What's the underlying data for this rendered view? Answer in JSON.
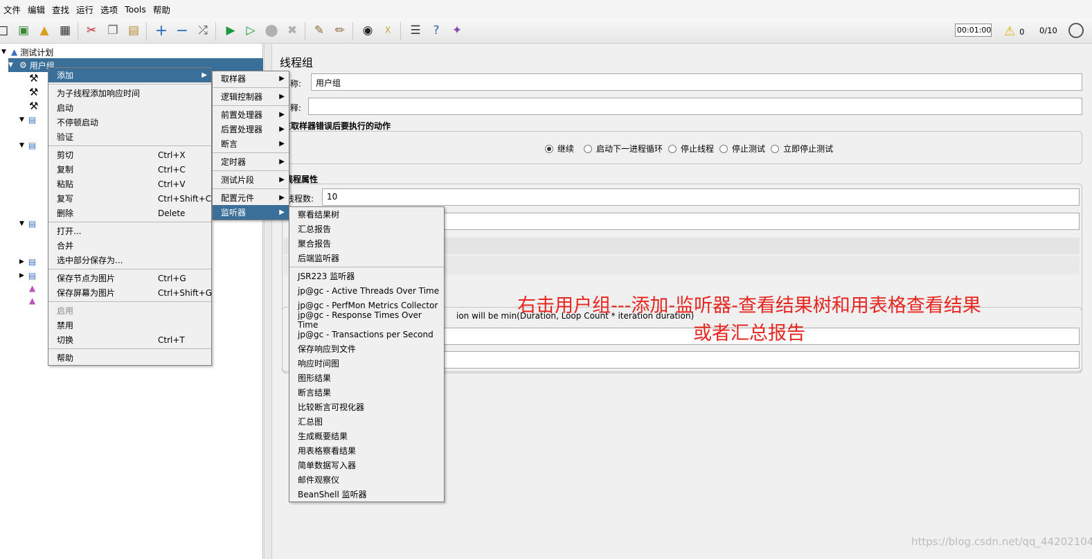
{
  "menubar": {
    "items": [
      "文件",
      "编辑",
      "查找",
      "运行",
      "选项",
      "Tools",
      "帮助"
    ]
  },
  "toolbar": {
    "timer": "00:01:00",
    "warning_count": "0",
    "thread_ratio": "0/10"
  },
  "tree": {
    "root": "测试计划",
    "selected": "用户组"
  },
  "panel": {
    "title": "线程组",
    "name_label": "称:",
    "name_value": "用户组",
    "comment_label": "释:",
    "error_action_title": "在取样器错误后要执行的动作",
    "error_actions": [
      "继续",
      "启动下一进程循环",
      "停止线程",
      "停止测试",
      "立即停止测试"
    ],
    "thread_props_title": "线程属性",
    "threads_label": "线程数:",
    "threads_value": "10",
    "duration_note": "ion will be min(Duration, Loop Count * iteration duration)"
  },
  "annotation": {
    "line1": "右击用户组---添加-监听器-查看结果树和用表格查看结果",
    "line2": "或者汇总报告"
  },
  "watermark": "https://blog.csdn.net/qq_44202104",
  "context_menu": {
    "items": [
      {
        "label": "添加",
        "shortcut": "",
        "submenu": true
      },
      {
        "sep": true
      },
      {
        "label": "为子线程添加响应时间",
        "shortcut": ""
      },
      {
        "label": "启动",
        "shortcut": ""
      },
      {
        "label": "不停顿启动",
        "shortcut": ""
      },
      {
        "label": "验证",
        "shortcut": ""
      },
      {
        "sep": true
      },
      {
        "label": "剪切",
        "shortcut": "Ctrl+X"
      },
      {
        "label": "复制",
        "shortcut": "Ctrl+C"
      },
      {
        "label": "粘贴",
        "shortcut": "Ctrl+V"
      },
      {
        "label": "复写",
        "shortcut": "Ctrl+Shift+C"
      },
      {
        "label": "删除",
        "shortcut": "Delete"
      },
      {
        "sep": true
      },
      {
        "label": "打开...",
        "shortcut": ""
      },
      {
        "label": "合并",
        "shortcut": ""
      },
      {
        "label": "选中部分保存为...",
        "shortcut": ""
      },
      {
        "sep": true
      },
      {
        "label": "保存节点为图片",
        "shortcut": "Ctrl+G"
      },
      {
        "label": "保存屏幕为图片",
        "shortcut": "Ctrl+Shift+G"
      },
      {
        "sep": true
      },
      {
        "label": "启用",
        "shortcut": "",
        "disabled": true
      },
      {
        "label": "禁用",
        "shortcut": ""
      },
      {
        "label": "切换",
        "shortcut": "Ctrl+T"
      },
      {
        "sep": true
      },
      {
        "label": "帮助",
        "shortcut": ""
      }
    ]
  },
  "add_submenu": {
    "items": [
      {
        "label": "取样器"
      },
      {
        "sep": true
      },
      {
        "label": "逻辑控制器"
      },
      {
        "sep": true
      },
      {
        "label": "前置处理器"
      },
      {
        "label": "后置处理器"
      },
      {
        "label": "断言"
      },
      {
        "sep": true
      },
      {
        "label": "定时器"
      },
      {
        "sep": true
      },
      {
        "label": "测试片段"
      },
      {
        "sep": true
      },
      {
        "label": "配置元件"
      },
      {
        "label": "监听器"
      }
    ]
  },
  "listener_submenu": {
    "items": [
      {
        "label": "察看结果树"
      },
      {
        "label": "汇总报告"
      },
      {
        "label": "聚合报告"
      },
      {
        "label": "后端监听器"
      },
      {
        "sep": true
      },
      {
        "label": "JSR223 监听器"
      },
      {
        "label": "jp@gc - Active Threads Over Time"
      },
      {
        "label": "jp@gc - PerfMon Metrics Collector"
      },
      {
        "label": "jp@gc - Response Times Over Time"
      },
      {
        "label": "jp@gc - Transactions per Second"
      },
      {
        "label": "保存响应到文件"
      },
      {
        "label": "响应时间图"
      },
      {
        "label": "图形结果"
      },
      {
        "label": "断言结果"
      },
      {
        "label": "比较断言可视化器"
      },
      {
        "label": "汇总图"
      },
      {
        "label": "生成概要结果"
      },
      {
        "label": "用表格察看结果"
      },
      {
        "label": "简单数据写入器"
      },
      {
        "label": "邮件观察仪"
      },
      {
        "label": "BeanShell 监听器"
      }
    ]
  }
}
